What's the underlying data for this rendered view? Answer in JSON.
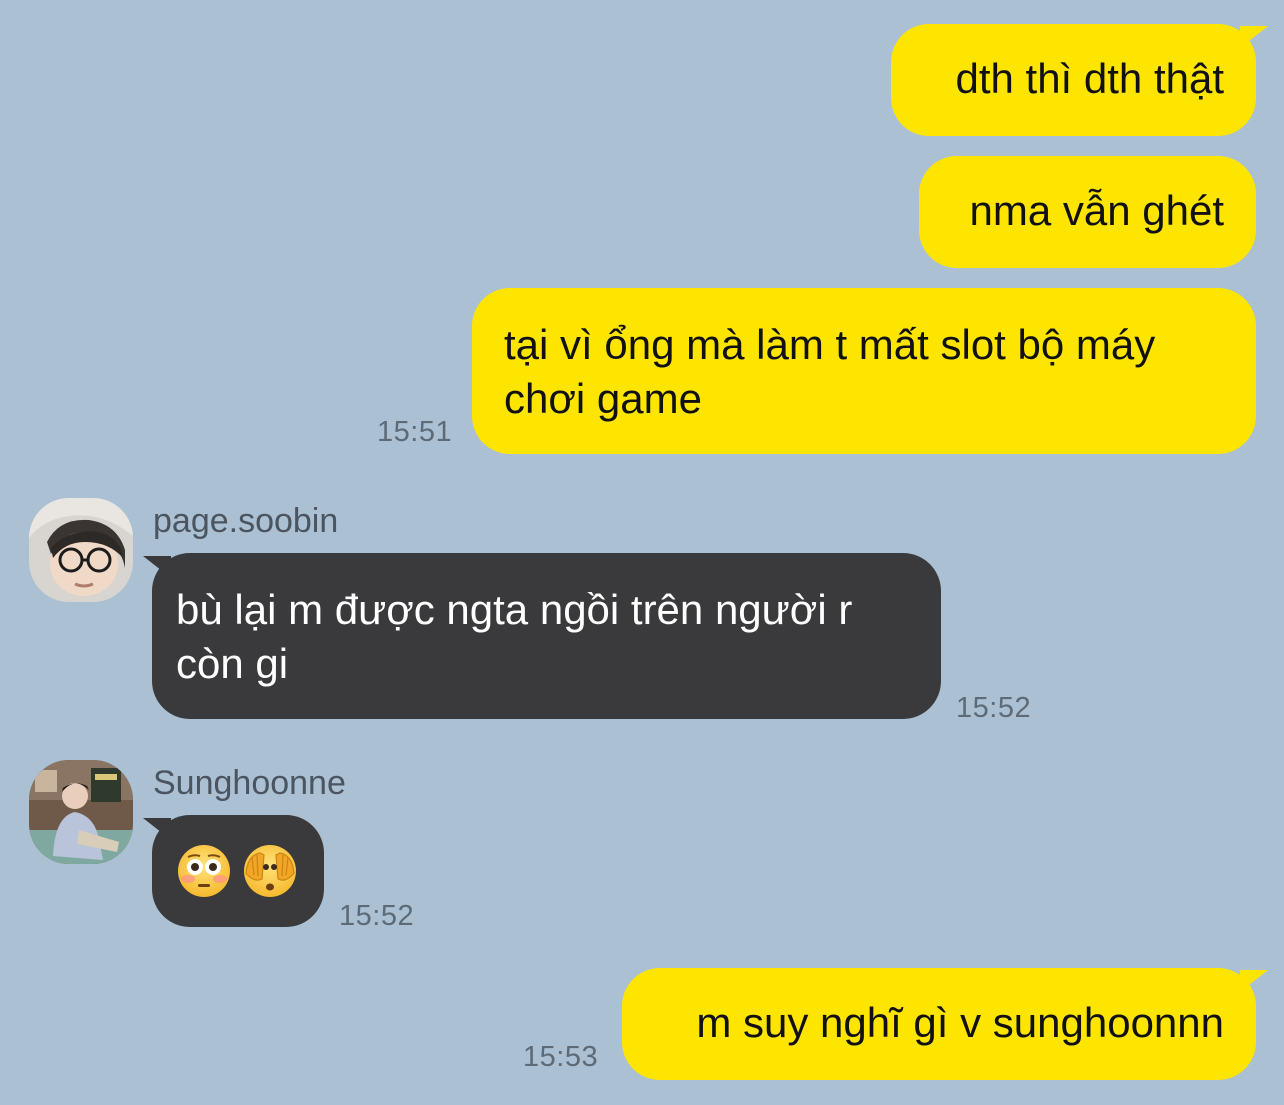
{
  "chat": {
    "messages": [
      {
        "id": "m1",
        "direction": "outgoing",
        "text": "dth thì dth thật",
        "time": ""
      },
      {
        "id": "m2",
        "direction": "outgoing",
        "text": "nma vẫn ghét",
        "time": ""
      },
      {
        "id": "m3",
        "direction": "outgoing",
        "text": "tại vì ổng mà làm t mất slot bộ máy chơi game",
        "time": "15:51"
      },
      {
        "id": "m4",
        "direction": "incoming",
        "sender": "page.soobin",
        "text": "bù lại m được ngta ngồi trên người r còn gi",
        "time": "15:52"
      },
      {
        "id": "m5",
        "direction": "incoming",
        "sender": "Sunghoonne",
        "emojis": [
          "flushed-face",
          "face-with-hands-over-eyes"
        ],
        "time": "15:52"
      },
      {
        "id": "m6",
        "direction": "outgoing",
        "text": "m suy nghĩ gì v sunghoonnn",
        "time": "15:53"
      }
    ]
  },
  "colors": {
    "background": "#abc1d3",
    "outgoing_bubble": "#fee500",
    "incoming_bubble": "#3a3a3c",
    "timestamp": "#5d6a78"
  }
}
